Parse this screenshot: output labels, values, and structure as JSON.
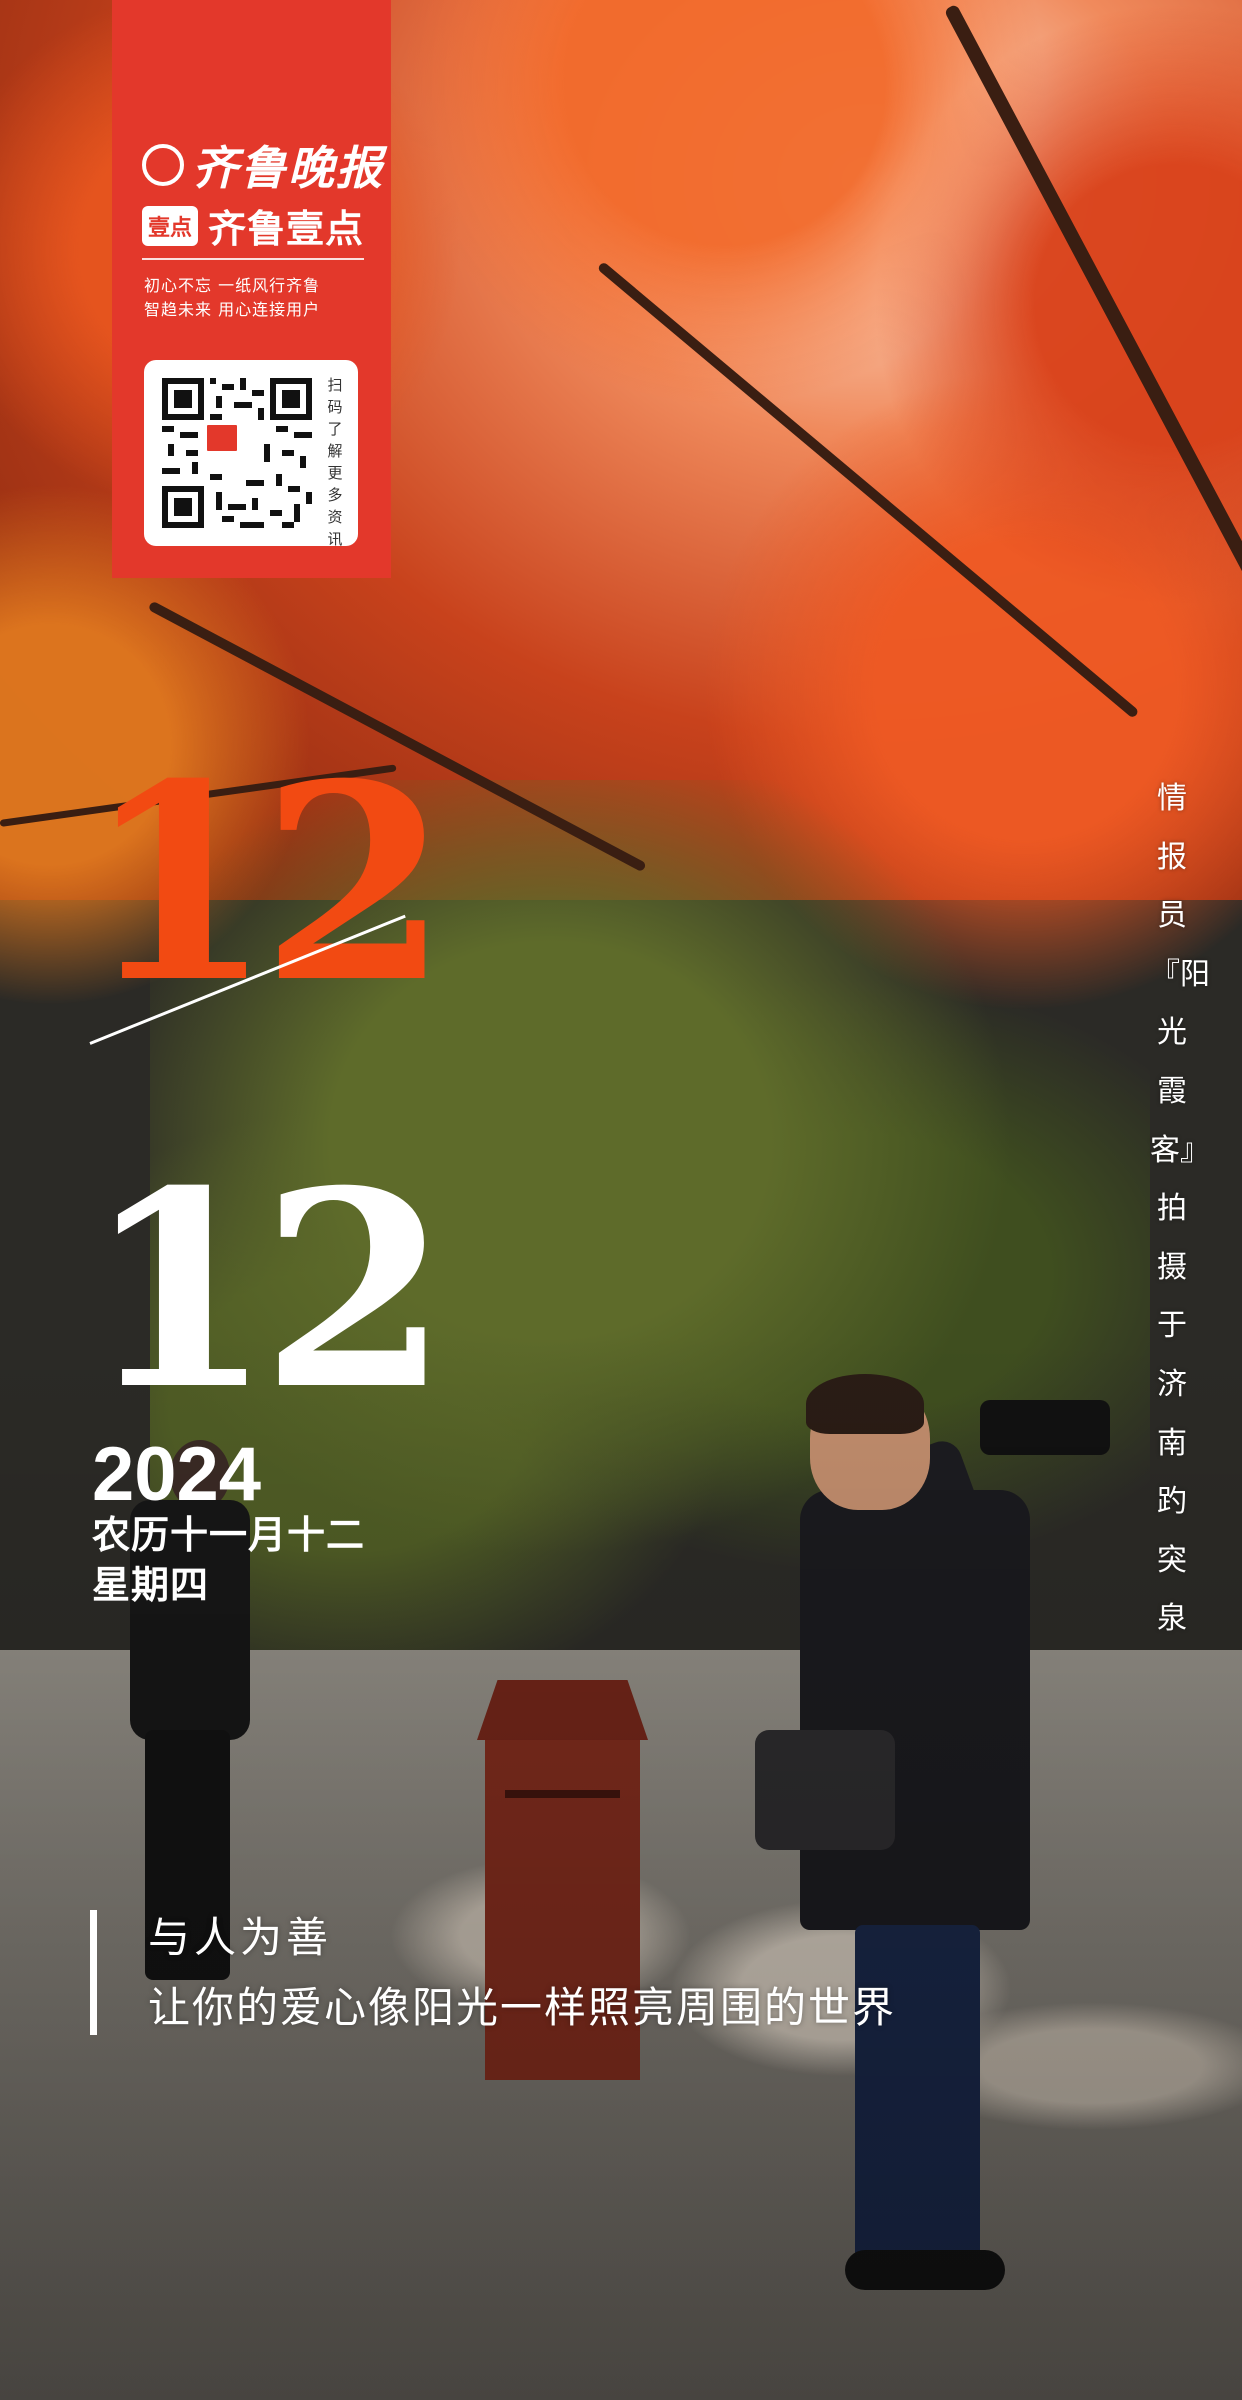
{
  "brand": {
    "color": "#e3382b",
    "newspaper_name": "齐鲁晚报",
    "app_badge": "壹点",
    "app_name": "齐鲁壹点",
    "slogan_line1": "初心不忘  一纸风行齐鲁",
    "slogan_line2": "智趋未来  用心连接用户",
    "qr_label": "扫码了解更多资讯",
    "qr_center_badge": "壹点"
  },
  "date": {
    "month": "12",
    "day": "12",
    "year": "2024",
    "lunar": "农历十一月十二",
    "weekday": "星期四",
    "month_color": "#f24a12"
  },
  "credit": "情报员『阳光霞客』拍摄于济南趵突泉",
  "quote": {
    "line1": "与人为善",
    "line2": "让你的爱心像阳光一样照亮周围的世界"
  }
}
